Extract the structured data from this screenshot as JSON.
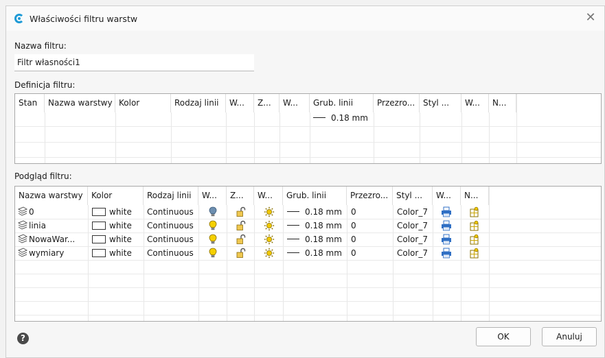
{
  "window": {
    "title": "Właściwości filtru warstw",
    "close_glyph": "✕"
  },
  "filter_name": {
    "label": "Nazwa filtru:",
    "value": "Filtr własności1"
  },
  "definition": {
    "label": "Definicja filtru:",
    "columns": [
      "Stan",
      "Nazwa warstwy",
      "Kolor",
      "Rodzaj linii",
      "W...",
      "Z...",
      "W...",
      "Grub. linii",
      "Przezro...",
      "Styl ...",
      "W...",
      "N..."
    ],
    "row": {
      "lineweight": "0.18 mm"
    }
  },
  "preview": {
    "label": "Podgląd filtru:",
    "columns": [
      "Nazwa warstwy",
      "Kolor",
      "Rodzaj linii",
      "W...",
      "Z...",
      "W...",
      "Grub. linii",
      "Przezro...",
      "Styl ...",
      "W...",
      "N..."
    ],
    "rows": [
      {
        "name": "0",
        "color": "white",
        "linetype": "Continuous",
        "lineweight": "0.18 mm",
        "transparency": "0",
        "plot_style": "Color_7",
        "visible_icon": "lightbulb-off-icon"
      },
      {
        "name": "linia",
        "color": "white",
        "linetype": "Continuous",
        "lineweight": "0.18 mm",
        "transparency": "0",
        "plot_style": "Color_7",
        "visible_icon": "lightbulb-on-icon"
      },
      {
        "name": "NowaWar...",
        "color": "white",
        "linetype": "Continuous",
        "lineweight": "0.18 mm",
        "transparency": "0",
        "plot_style": "Color_7",
        "visible_icon": "lightbulb-on-icon"
      },
      {
        "name": "wymiary",
        "color": "white",
        "linetype": "Continuous",
        "lineweight": "0.18 mm",
        "transparency": "0",
        "plot_style": "Color_7",
        "visible_icon": "lightbulb-on-icon"
      }
    ]
  },
  "buttons": {
    "help": "?",
    "ok": "OK",
    "cancel": "Anuluj"
  },
  "colors": {
    "accent": "#1e9ad6",
    "bulb_on": "#f5d000",
    "sun": "#f0c800",
    "printer": "#2f6fc4"
  }
}
